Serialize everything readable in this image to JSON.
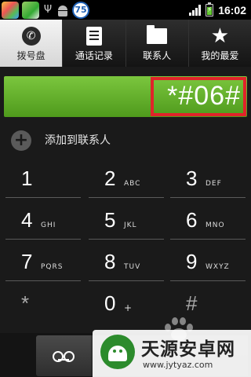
{
  "status_bar": {
    "notification_badge": "75",
    "time": "16:02"
  },
  "tabs": [
    {
      "label": "拨号盘",
      "icon": "phone-icon",
      "selected": true
    },
    {
      "label": "通话记录",
      "icon": "call-log-icon",
      "selected": false
    },
    {
      "label": "联系人",
      "icon": "contacts-icon",
      "selected": false
    },
    {
      "label": "我的最爱",
      "icon": "star-icon",
      "selected": false
    }
  ],
  "dialer": {
    "number": "*#06#",
    "add_to_contacts": "添加到联系人"
  },
  "keypad": [
    {
      "digit": "1",
      "letters": ""
    },
    {
      "digit": "2",
      "letters": "ABC"
    },
    {
      "digit": "3",
      "letters": "DEF"
    },
    {
      "digit": "4",
      "letters": "GHI"
    },
    {
      "digit": "5",
      "letters": "JKL"
    },
    {
      "digit": "6",
      "letters": "MNO"
    },
    {
      "digit": "7",
      "letters": "PQRS"
    },
    {
      "digit": "8",
      "letters": "TUV"
    },
    {
      "digit": "9",
      "letters": "WXYZ"
    },
    {
      "digit": "*",
      "letters": ""
    },
    {
      "digit": "0",
      "letters": "+"
    },
    {
      "digit": "#",
      "letters": ""
    }
  ],
  "watermark": {
    "title": "天源安卓网",
    "url": "www.jytyaz.com"
  },
  "colors": {
    "display_green": "#5fae2a",
    "highlight_red": "#e0242a"
  }
}
